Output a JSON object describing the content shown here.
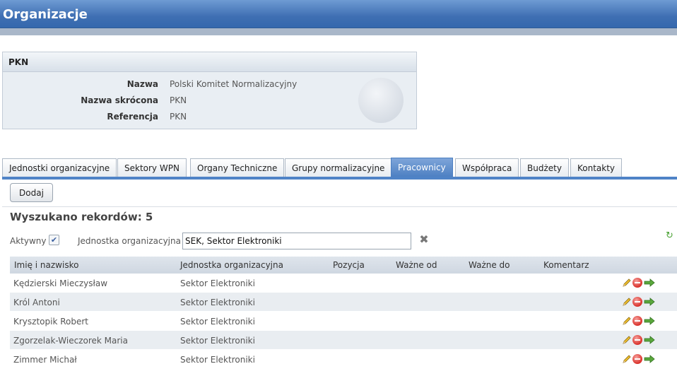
{
  "app": {
    "title": "Organizacje"
  },
  "organization": {
    "header": "PKN",
    "fields": [
      {
        "label": "Nazwa",
        "value": "Polski Komitet Normalizacyjny"
      },
      {
        "label": "Nazwa skrócona",
        "value": "PKN"
      },
      {
        "label": "Referencja",
        "value": "PKN"
      }
    ]
  },
  "tabs": [
    {
      "label": "Jednostki organizacyjne",
      "active": false
    },
    {
      "label": "Sektory WPN",
      "active": false
    },
    {
      "label": "Organy Techniczne",
      "active": false
    },
    {
      "label": "Grupy normalizacyjne",
      "active": false
    },
    {
      "label": "Pracownicy",
      "active": true
    },
    {
      "label": "Współpraca",
      "active": false
    },
    {
      "label": "Budżety",
      "active": false
    },
    {
      "label": "Kontakty",
      "active": false
    }
  ],
  "toolbar": {
    "add_label": "Dodaj"
  },
  "results": {
    "title": "Wyszukano rekordów: 5"
  },
  "filters": {
    "active_label": "Aktywny",
    "active_checked": true,
    "unit_label": "Jednostka organizacyjna",
    "unit_value": "SEK, Sektor Elektroniki"
  },
  "table": {
    "columns": [
      "Imię i nazwisko",
      "Jednostka organizacyjna",
      "Pozycja",
      "Ważne od",
      "Ważne do",
      "Komentarz"
    ],
    "rows": [
      {
        "name": "Kędzierski Mieczysław",
        "unit": "Sektor Elektroniki",
        "position": "",
        "valid_from": "",
        "valid_to": "",
        "comment": ""
      },
      {
        "name": "Król Antoni",
        "unit": "Sektor Elektroniki",
        "position": "",
        "valid_from": "",
        "valid_to": "",
        "comment": ""
      },
      {
        "name": "Krysztopik Robert",
        "unit": "Sektor Elektroniki",
        "position": "",
        "valid_from": "",
        "valid_to": "",
        "comment": ""
      },
      {
        "name": "Zgorzelak-Wieczorek Maria",
        "unit": "Sektor Elektroniki",
        "position": "",
        "valid_from": "",
        "valid_to": "",
        "comment": ""
      },
      {
        "name": "Zimmer Michał",
        "unit": "Sektor Elektroniki",
        "position": "",
        "valid_from": "",
        "valid_to": "",
        "comment": ""
      }
    ],
    "row_actions": [
      "pencil-edit-icon",
      "delete-icon",
      "move-arrow-icon"
    ]
  },
  "colors": {
    "header_blue": "#3f6fb3",
    "active_tab": "#4c7fc2",
    "delete_red": "#d9302a",
    "refresh_green": "#4aa234"
  }
}
